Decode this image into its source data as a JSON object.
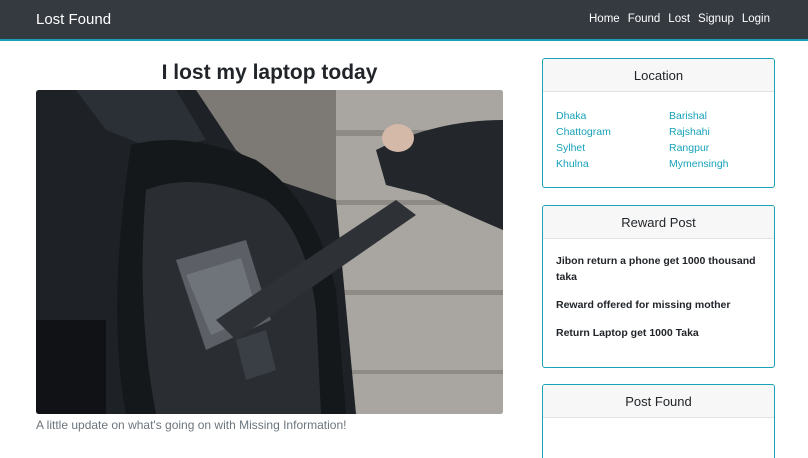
{
  "navbar": {
    "brand": "Lost Found",
    "links": [
      "Home",
      "Found",
      "Lost",
      "Signup",
      "Login"
    ]
  },
  "post": {
    "title": "I lost my laptop today",
    "caption": "A little update on what's going on with Missing Information!"
  },
  "location_card": {
    "title": "Location",
    "cities": [
      "Dhaka",
      "Barishal",
      "Chattogram",
      "Rajshahi",
      "Sylhet",
      "Rangpur",
      "Khulna",
      "Mymensingh"
    ]
  },
  "reward_card": {
    "title": "Reward Post",
    "items": [
      "Jibon return a phone get 1000 thousand taka",
      "Reward offered for missing mother",
      "Return Laptop get 1000 Taka"
    ]
  },
  "found_card": {
    "title": "Post Found"
  },
  "colors": {
    "navbar_bg": "#343a40",
    "accent": "#17a2b8"
  }
}
